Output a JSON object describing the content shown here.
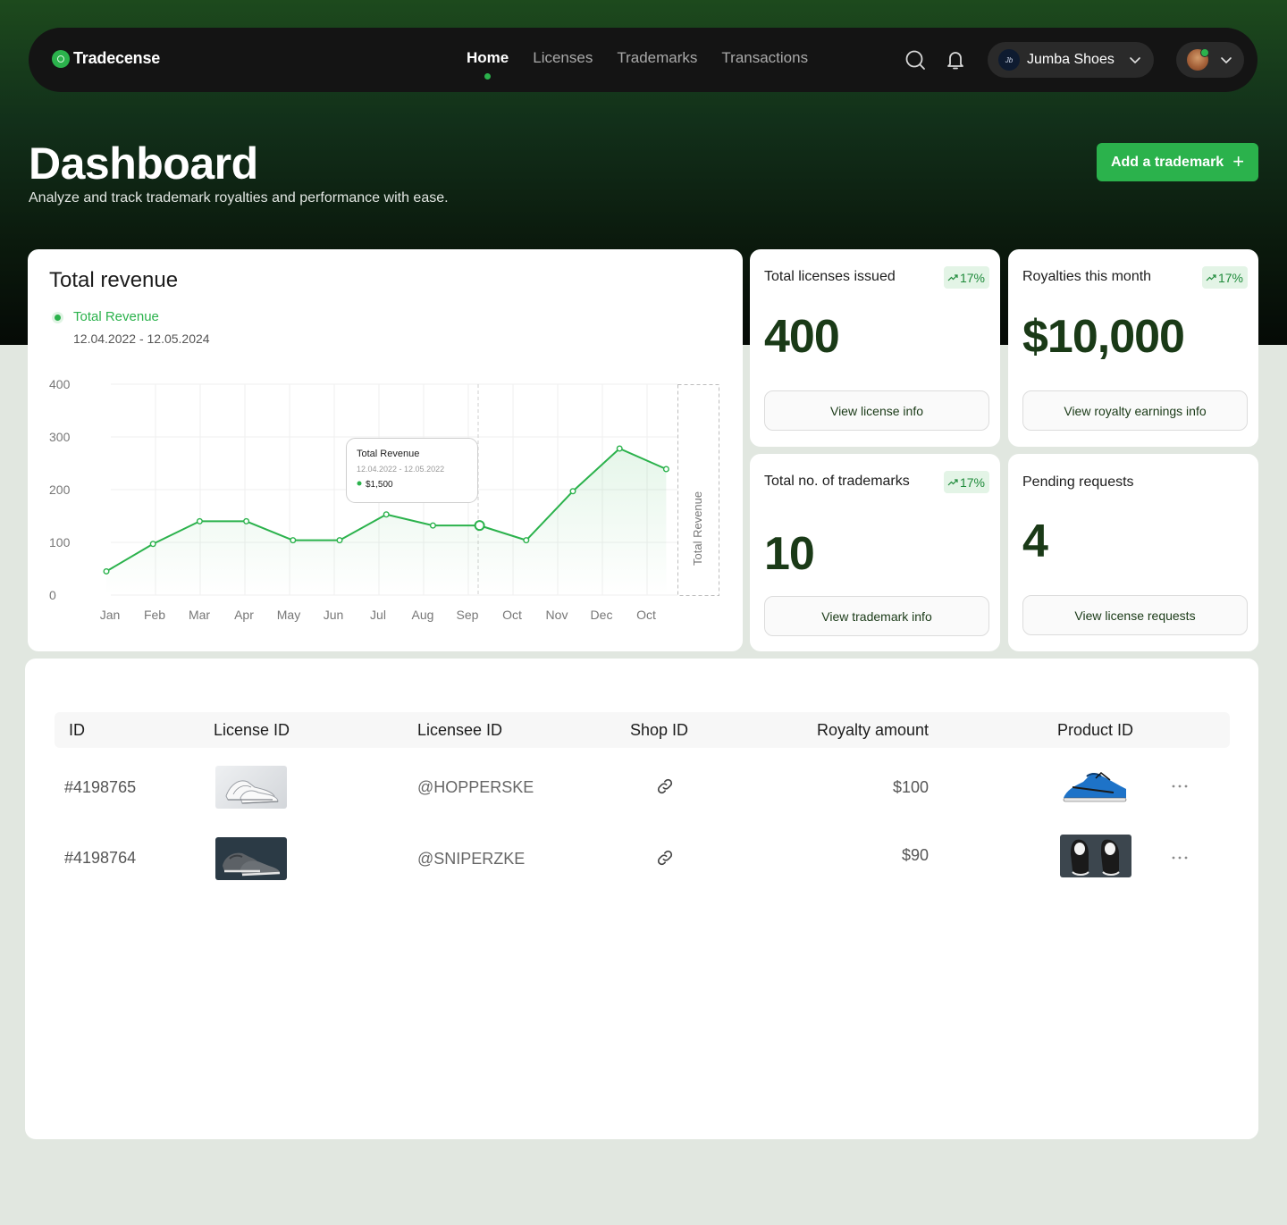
{
  "brand": {
    "name": "Tradecense",
    "logo_icon": "tradecense-logo-icon"
  },
  "nav": {
    "links": [
      {
        "label": "Home",
        "active": true
      },
      {
        "label": "Licenses",
        "active": false
      },
      {
        "label": "Trademarks",
        "active": false
      },
      {
        "label": "Transactions",
        "active": false
      }
    ],
    "store": {
      "name": "Jumba Shoes"
    }
  },
  "hero": {
    "title": "Dashboard",
    "subtitle": "Analyze and track trademark royalties and performance with ease.",
    "add_button": "Add a trademark",
    "add_icon": "+"
  },
  "revenue": {
    "title": "Total revenue",
    "legend_label": "Total Revenue",
    "date_range": "12.04.2022 - 12.05.2024",
    "tooltip": {
      "title": "Total Revenue",
      "range": "12.04.2022 - 12.05.2022",
      "value": "$1,500"
    },
    "side_label": "Total Revenue"
  },
  "chart_data": {
    "type": "area",
    "categories": [
      "Jan",
      "Feb",
      "Mar",
      "Apr",
      "May",
      "Jun",
      "Jul",
      "Aug",
      "Sep",
      "Oct",
      "Nov",
      "Dec",
      "Oct"
    ],
    "series": [
      {
        "name": "Total Revenue",
        "values": [
          45,
          97,
          140,
          140,
          104,
          104,
          153,
          132,
          132,
          104,
          197,
          278,
          239
        ]
      }
    ],
    "y_ticks": [
      0,
      100,
      200,
      300,
      400
    ],
    "ylim": [
      0,
      400
    ],
    "highlight_index": 8,
    "grid": true,
    "color": "#2bb24c"
  },
  "stats": [
    {
      "title": "Total licenses issued",
      "badge": "17%",
      "value": "400",
      "button": "View license info"
    },
    {
      "title": "Royalties this month",
      "badge": "17%",
      "value": "$10,000",
      "button": "View royalty earnings info"
    },
    {
      "title": "Total no. of trademarks",
      "badge": "17%",
      "value": "10",
      "button": "View trademark info"
    },
    {
      "title": "Pending requests",
      "badge": "",
      "value": "4",
      "button": "View license requests"
    }
  ],
  "table": {
    "headers": [
      "ID",
      "License ID",
      "Licensee ID",
      "Shop ID",
      "Royalty amount",
      "Product ID"
    ],
    "rows": [
      {
        "id": "#4198765",
        "licensee": "@HOPPERSKE",
        "amount": "$100"
      },
      {
        "id": "#4198764",
        "licensee": "@SNIPERZKE",
        "amount": "$90"
      }
    ]
  },
  "colors": {
    "accent": "#2bb24c",
    "dark_text": "#1a3a17",
    "badge_bg": "#e3f4e6"
  }
}
